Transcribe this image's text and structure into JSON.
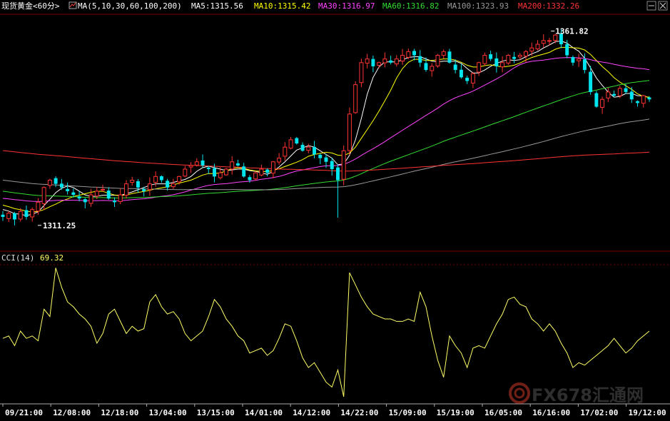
{
  "header": {
    "instrument": "现货黄金<60分>",
    "indicator": "MA(5,10,30,60,100,200)",
    "ma_labels": [
      {
        "text": "MA5:1315.56",
        "color": "#ffffff"
      },
      {
        "text": "MA10:1315.42",
        "color": "#ffff00"
      },
      {
        "text": "MA30:1316.97",
        "color": "#ff44ff"
      },
      {
        "text": "MA60:1316.82",
        "color": "#33dd33"
      },
      {
        "text": "MA100:1323.93",
        "color": "#999999"
      },
      {
        "text": "MA200:1332.26",
        "color": "#ff3333"
      }
    ]
  },
  "cci_header": {
    "label": "CCI(14)",
    "value": "69.32"
  },
  "watermark": "FX678汇通网",
  "colors": {
    "up": "#ff3333",
    "down": "#00e5ee",
    "cci": "#ffff66",
    "grid": "#7a0000",
    "axis": "#aaaaaa"
  },
  "icons": [
    "chart-type-icon",
    "minimize-icon",
    "close-icon"
  ],
  "chart_data": [
    {
      "type": "candlestick",
      "title": "现货黄金<60分>",
      "x_ticks": [
        "09/21:00",
        "12/08:00",
        "12/18:00",
        "13/04:00",
        "13/15:00",
        "14/01:00",
        "14/12:00",
        "14/22:00",
        "15/09:00",
        "15/19:00",
        "16/05:00",
        "16/16:00",
        "17/02:00",
        "19/12:00"
      ],
      "ylim": [
        1305,
        1366
      ],
      "annotations": [
        {
          "text": "1361.82",
          "type": "high",
          "x_index": 94
        },
        {
          "text": "1311.25",
          "type": "low",
          "x_index": 4
        }
      ],
      "anchor_prices": [
        1312,
        1313,
        1311.3,
        1313.5,
        1312,
        1314,
        1316,
        1320,
        1322,
        1321,
        1320,
        1319,
        1318,
        1317,
        1316,
        1318,
        1319,
        1319.5,
        1317,
        1316,
        1318,
        1321,
        1322,
        1320,
        1319,
        1321,
        1323,
        1322,
        1320,
        1321,
        1323,
        1325,
        1326,
        1327,
        1326,
        1325,
        1323,
        1324,
        1325,
        1327,
        1326,
        1323,
        1322,
        1324,
        1325,
        1324,
        1327,
        1328,
        1331,
        1333,
        1332,
        1330,
        1331,
        1329,
        1328,
        1327,
        1325,
        1322,
        1330,
        1340,
        1348,
        1354,
        1355,
        1353,
        1354,
        1355,
        1354,
        1355,
        1356,
        1357,
        1356,
        1354,
        1352,
        1353,
        1356,
        1357,
        1354,
        1352,
        1350,
        1349,
        1351,
        1354,
        1356,
        1355,
        1353,
        1354,
        1356,
        1355,
        1356,
        1357,
        1358,
        1359,
        1360,
        1360,
        1361.5,
        1359,
        1356,
        1354,
        1355,
        1352,
        1346,
        1342,
        1344,
        1346,
        1345,
        1347,
        1346,
        1344,
        1343,
        1345,
        1344
      ],
      "ma_series": [
        {
          "name": "MA5",
          "last": 1315.56,
          "color": "#ffffff"
        },
        {
          "name": "MA10",
          "last": 1315.42,
          "color": "#ffff00"
        },
        {
          "name": "MA30",
          "last": 1316.97,
          "color": "#ff44ff"
        },
        {
          "name": "MA60",
          "last": 1316.82,
          "color": "#33dd33"
        },
        {
          "name": "MA100",
          "last": 1323.93,
          "color": "#999999"
        },
        {
          "name": "MA200",
          "last": 1332.26,
          "color": "#ff3333"
        }
      ]
    },
    {
      "type": "line",
      "title": "CCI(14)",
      "ylim": [
        -280,
        260
      ],
      "series": [
        {
          "name": "CCI(14)",
          "last": 69.32,
          "values": [
            -40,
            -30,
            -70,
            -10,
            -40,
            -30,
            -50,
            80,
            50,
            250,
            170,
            110,
            90,
            60,
            40,
            10,
            -60,
            -20,
            60,
            80,
            30,
            -20,
            10,
            -10,
            0,
            110,
            140,
            90,
            60,
            70,
            40,
            -20,
            -50,
            -30,
            -10,
            50,
            120,
            90,
            40,
            10,
            -30,
            -50,
            -100,
            -90,
            -80,
            -110,
            -90,
            -40,
            20,
            10,
            -50,
            -120,
            -160,
            -140,
            -180,
            -220,
            -240,
            -170,
            -280,
            230,
            180,
            130,
            90,
            60,
            50,
            40,
            40,
            30,
            30,
            40,
            30,
            150,
            90,
            -30,
            -130,
            -200,
            -30,
            -70,
            -100,
            -160,
            -80,
            -70,
            -80,
            -30,
            20,
            60,
            120,
            130,
            100,
            90,
            40,
            20,
            -10,
            20,
            -10,
            -60,
            -100,
            -160,
            -140,
            -150,
            -130,
            -110,
            -90,
            -70,
            -40,
            -70,
            -100,
            -80,
            -50,
            -30,
            -10
          ]
        }
      ]
    }
  ]
}
